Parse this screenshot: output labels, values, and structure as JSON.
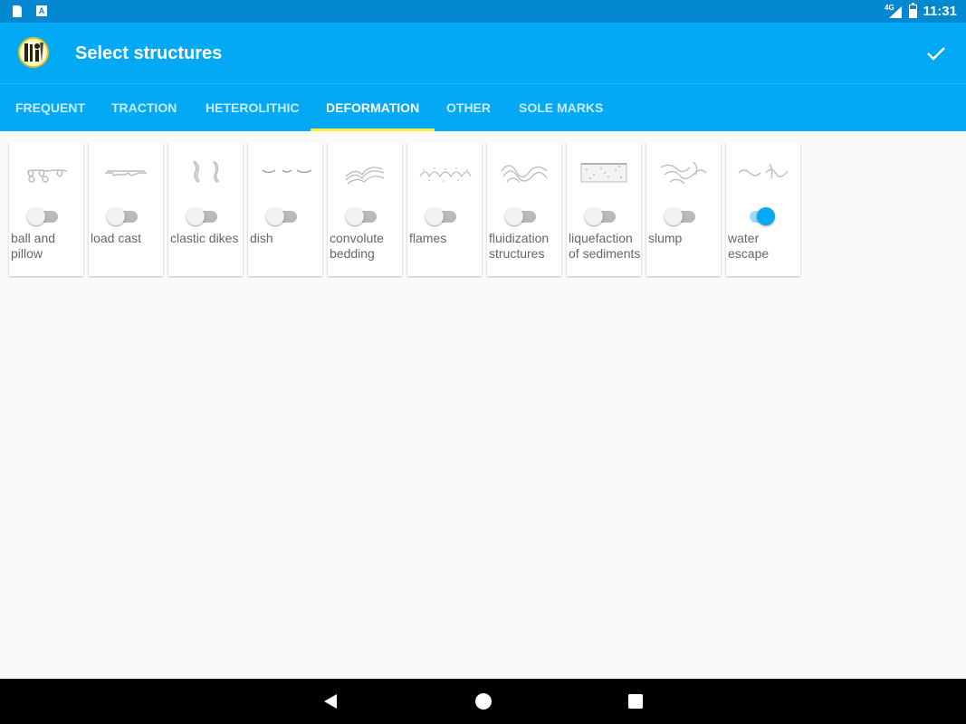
{
  "status_bar": {
    "network": "4G",
    "time": "11:31"
  },
  "header": {
    "title": "Select structures",
    "confirm_icon": "check-icon"
  },
  "tabs": [
    {
      "label": "FREQUENT",
      "active": false
    },
    {
      "label": "TRACTION",
      "active": false
    },
    {
      "label": "HETEROLITHIC",
      "active": false
    },
    {
      "label": "DEFORMATION",
      "active": true
    },
    {
      "label": "OTHER",
      "active": false
    },
    {
      "label": "SOLE MARKS",
      "active": false
    }
  ],
  "structures": [
    {
      "label": "ball and pillow",
      "icon": "ball-and-pillow-icon",
      "enabled": false
    },
    {
      "label": "load cast",
      "icon": "load-cast-icon",
      "enabled": false
    },
    {
      "label": "clastic dikes",
      "icon": "clastic-dikes-icon",
      "enabled": false
    },
    {
      "label": "dish",
      "icon": "dish-icon",
      "enabled": false
    },
    {
      "label": "convolute bedding",
      "icon": "convolute-bedding-icon",
      "enabled": false
    },
    {
      "label": "flames",
      "icon": "flames-icon",
      "enabled": false
    },
    {
      "label": "fluidization structures",
      "icon": "fluidization-icon",
      "enabled": false
    },
    {
      "label": "liquefaction of sediments",
      "icon": "liquefaction-icon",
      "enabled": false
    },
    {
      "label": "slump",
      "icon": "slump-icon",
      "enabled": false
    },
    {
      "label": "water escape",
      "icon": "water-escape-icon",
      "enabled": true
    }
  ],
  "colors": {
    "primary": "#03a9f4",
    "primary_dark": "#0288d1",
    "tab_indicator": "#ffeb3b"
  }
}
